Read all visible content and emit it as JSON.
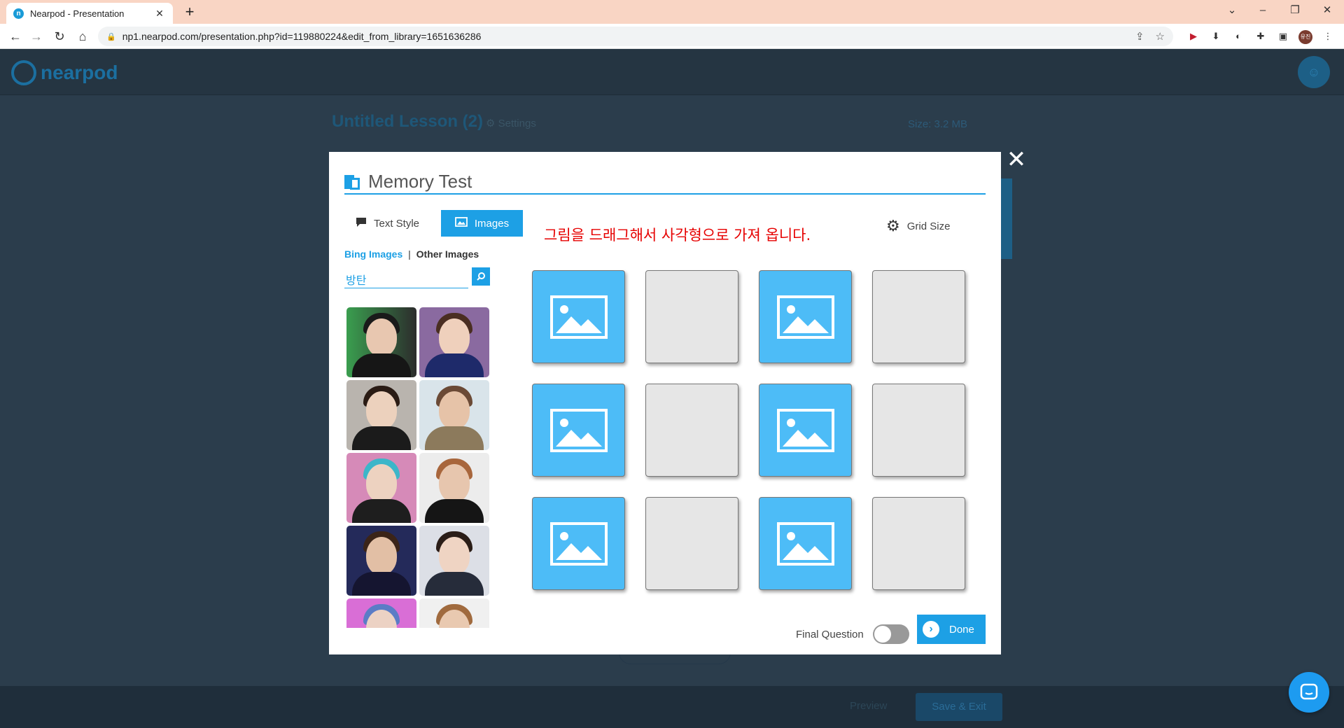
{
  "browser": {
    "tab_title": "Nearpod - Presentation",
    "url": "np1.nearpod.com/presentation.php?id=119880224&edit_from_library=1651636286",
    "profile_initials": "유진"
  },
  "app": {
    "logo_text": "nearpod",
    "lesson_title": "Untitled Lesson (2)",
    "settings_label": "Settings",
    "size_label": "Size:",
    "size_value": "3.2 MB",
    "preview_label": "Preview",
    "save_exit_label": "Save & Exit"
  },
  "modal": {
    "title": "Memory Test",
    "tabs": [
      {
        "label": "Text Style",
        "icon": "speech-bubble-icon",
        "active": false
      },
      {
        "label": "Images",
        "icon": "image-icon",
        "active": true
      }
    ],
    "instruction": "그림을 드래그해서 사각형으로 가져 옵니다.",
    "grid_size_label": "Grid Size",
    "image_sources": {
      "bing": "Bing Images",
      "separator": "|",
      "other": "Other Images"
    },
    "search_value": "방탄",
    "search_placeholder": "",
    "final_question_label": "Final Question",
    "final_question_on": false,
    "done_label": "Done",
    "accent_color": "#1da0e5",
    "card_filled_color": "#4dbcf7",
    "card_empty_color": "#e6e6e6",
    "grid": {
      "rows": 3,
      "cols": 4,
      "cells": [
        [
          "image",
          "empty",
          "image",
          "empty"
        ],
        [
          "image",
          "empty",
          "image",
          "empty"
        ],
        [
          "image",
          "empty",
          "image",
          "empty"
        ]
      ]
    },
    "image_results_count": 10
  }
}
